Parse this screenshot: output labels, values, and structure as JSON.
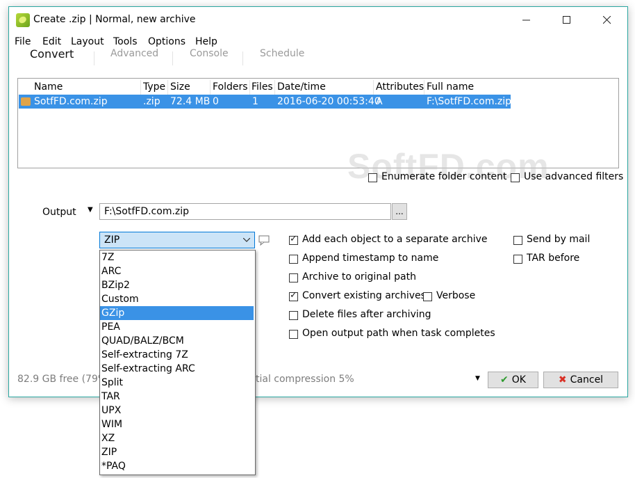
{
  "window": {
    "title": "Create .zip | Normal, new archive"
  },
  "menu": [
    "File",
    "Edit",
    "Layout",
    "Tools",
    "Options",
    "Help"
  ],
  "tabs": [
    "Convert",
    "Advanced",
    "Console",
    "Schedule"
  ],
  "table": {
    "columns": [
      "Name",
      "Type",
      "Size",
      "Folders",
      "Files",
      "Date/time",
      "Attributes",
      "Full name"
    ],
    "rows": [
      [
        "SotfFD.com.zip",
        ".zip",
        "72.4 MB",
        "0",
        "1",
        "2016-06-20 00:53:40",
        "A",
        "F:\\SotfFD.com.zip"
      ]
    ]
  },
  "filters": {
    "enumerate": "Enumerate folder content",
    "advanced": "Use advanced filters"
  },
  "output": {
    "label": "Output",
    "path": "F:\\SotfFD.com.zip",
    "browse": "..."
  },
  "format": {
    "selected": "ZIP",
    "options": [
      "7Z",
      "ARC",
      "BZip2",
      "Custom",
      "GZip",
      "PEA",
      "QUAD/BALZ/BCM",
      "Self-extracting 7Z",
      "Self-extracting ARC",
      "Split",
      "TAR",
      "UPX",
      "WIM",
      "XZ",
      "ZIP",
      "*PAQ"
    ],
    "highlighted": "GZip"
  },
  "options": {
    "separate": "Add each object to a separate archive",
    "timestamp": "Append timestamp to name",
    "original_path": "Archive to original path",
    "convert": "Convert existing archives",
    "verbose": "Verbose",
    "delete": "Delete files after archiving",
    "open_output": "Open output path when task completes",
    "send_mail": "Send by mail",
    "tar_before": "TAR before"
  },
  "status": {
    "free": "82.9 GB free (79%",
    "compression": "tial compression 5%"
  },
  "buttons": {
    "ok": "OK",
    "cancel": "Cancel"
  },
  "watermark": "SoftFD.com",
  "colors": {
    "selection": "#3a92e6",
    "accent_border": "#2aa6a0",
    "ok_check": "#2e9b2e",
    "cancel_x": "#d93025"
  }
}
